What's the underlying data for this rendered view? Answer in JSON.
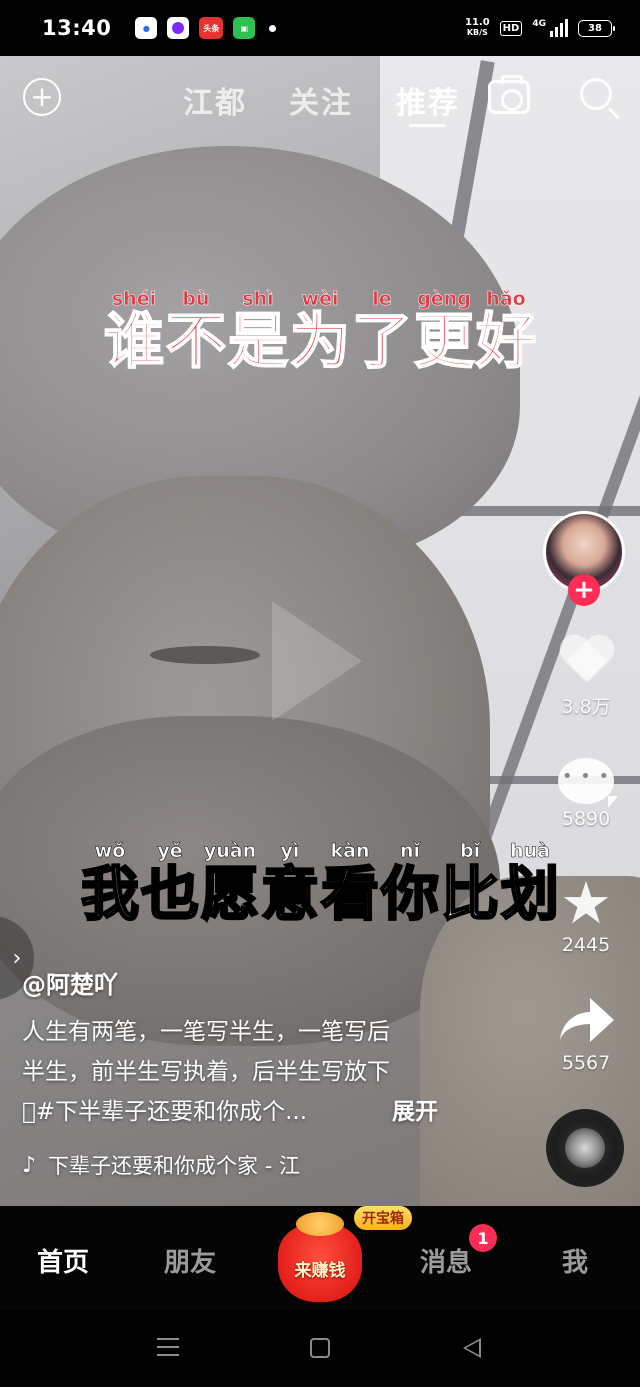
{
  "status_bar": {
    "time": "13:40",
    "notification_icons": [
      "baidu-app-icon",
      "purple-app-icon",
      "toutiao-app-icon",
      "green-bag-app-icon"
    ],
    "toutiao_label": "头条",
    "net_speed_value": "11.0",
    "net_speed_unit": "KB/S",
    "hd_label": "HD",
    "network_label": "4G",
    "battery_level": "38"
  },
  "top_nav": {
    "tabs": [
      {
        "label": "江都",
        "active": false
      },
      {
        "label": "关注",
        "active": false
      },
      {
        "label": "推荐",
        "active": true
      }
    ]
  },
  "lyrics": {
    "line1": [
      {
        "pinyin": "shéi",
        "char": "谁"
      },
      {
        "pinyin": "bù",
        "char": "不"
      },
      {
        "pinyin": "shì",
        "char": "是"
      },
      {
        "pinyin": "wèi",
        "char": "为"
      },
      {
        "pinyin": "le",
        "char": "了"
      },
      {
        "pinyin": "gèng",
        "char": "更"
      },
      {
        "pinyin": "hǎo",
        "char": "好"
      }
    ],
    "line2": [
      {
        "pinyin": "wǒ",
        "char": "我"
      },
      {
        "pinyin": "yě",
        "char": "也"
      },
      {
        "pinyin": "yuàn",
        "char": "愿"
      },
      {
        "pinyin": "yì",
        "char": "意"
      },
      {
        "pinyin": "kàn",
        "char": "看"
      },
      {
        "pinyin": "nǐ",
        "char": "你"
      },
      {
        "pinyin": "bǐ",
        "char": "比"
      },
      {
        "pinyin": "huà",
        "char": "划"
      }
    ]
  },
  "actions": {
    "likes": "3.8万",
    "comments": "5890",
    "favorites": "2445",
    "shares": "5567"
  },
  "post": {
    "author": "@阿楚吖",
    "description_lines": [
      "人生有两笔，一笔写半生，一笔写后",
      "半生，前半生写执着，后半生写放下",
      "\u0000#下半辈子还要和你成个..."
    ],
    "expand_label": "展开",
    "music": "下辈子还要和你成个家 - 江"
  },
  "bottom_tabs": {
    "home": "首页",
    "friends": "朋友",
    "earn": "来赚钱",
    "treasure": "开宝箱",
    "messages": "消息",
    "messages_badge": "1",
    "me": "我"
  },
  "colors": {
    "accent_red": "#fd2c55",
    "lyric_red": "#e23a45"
  }
}
